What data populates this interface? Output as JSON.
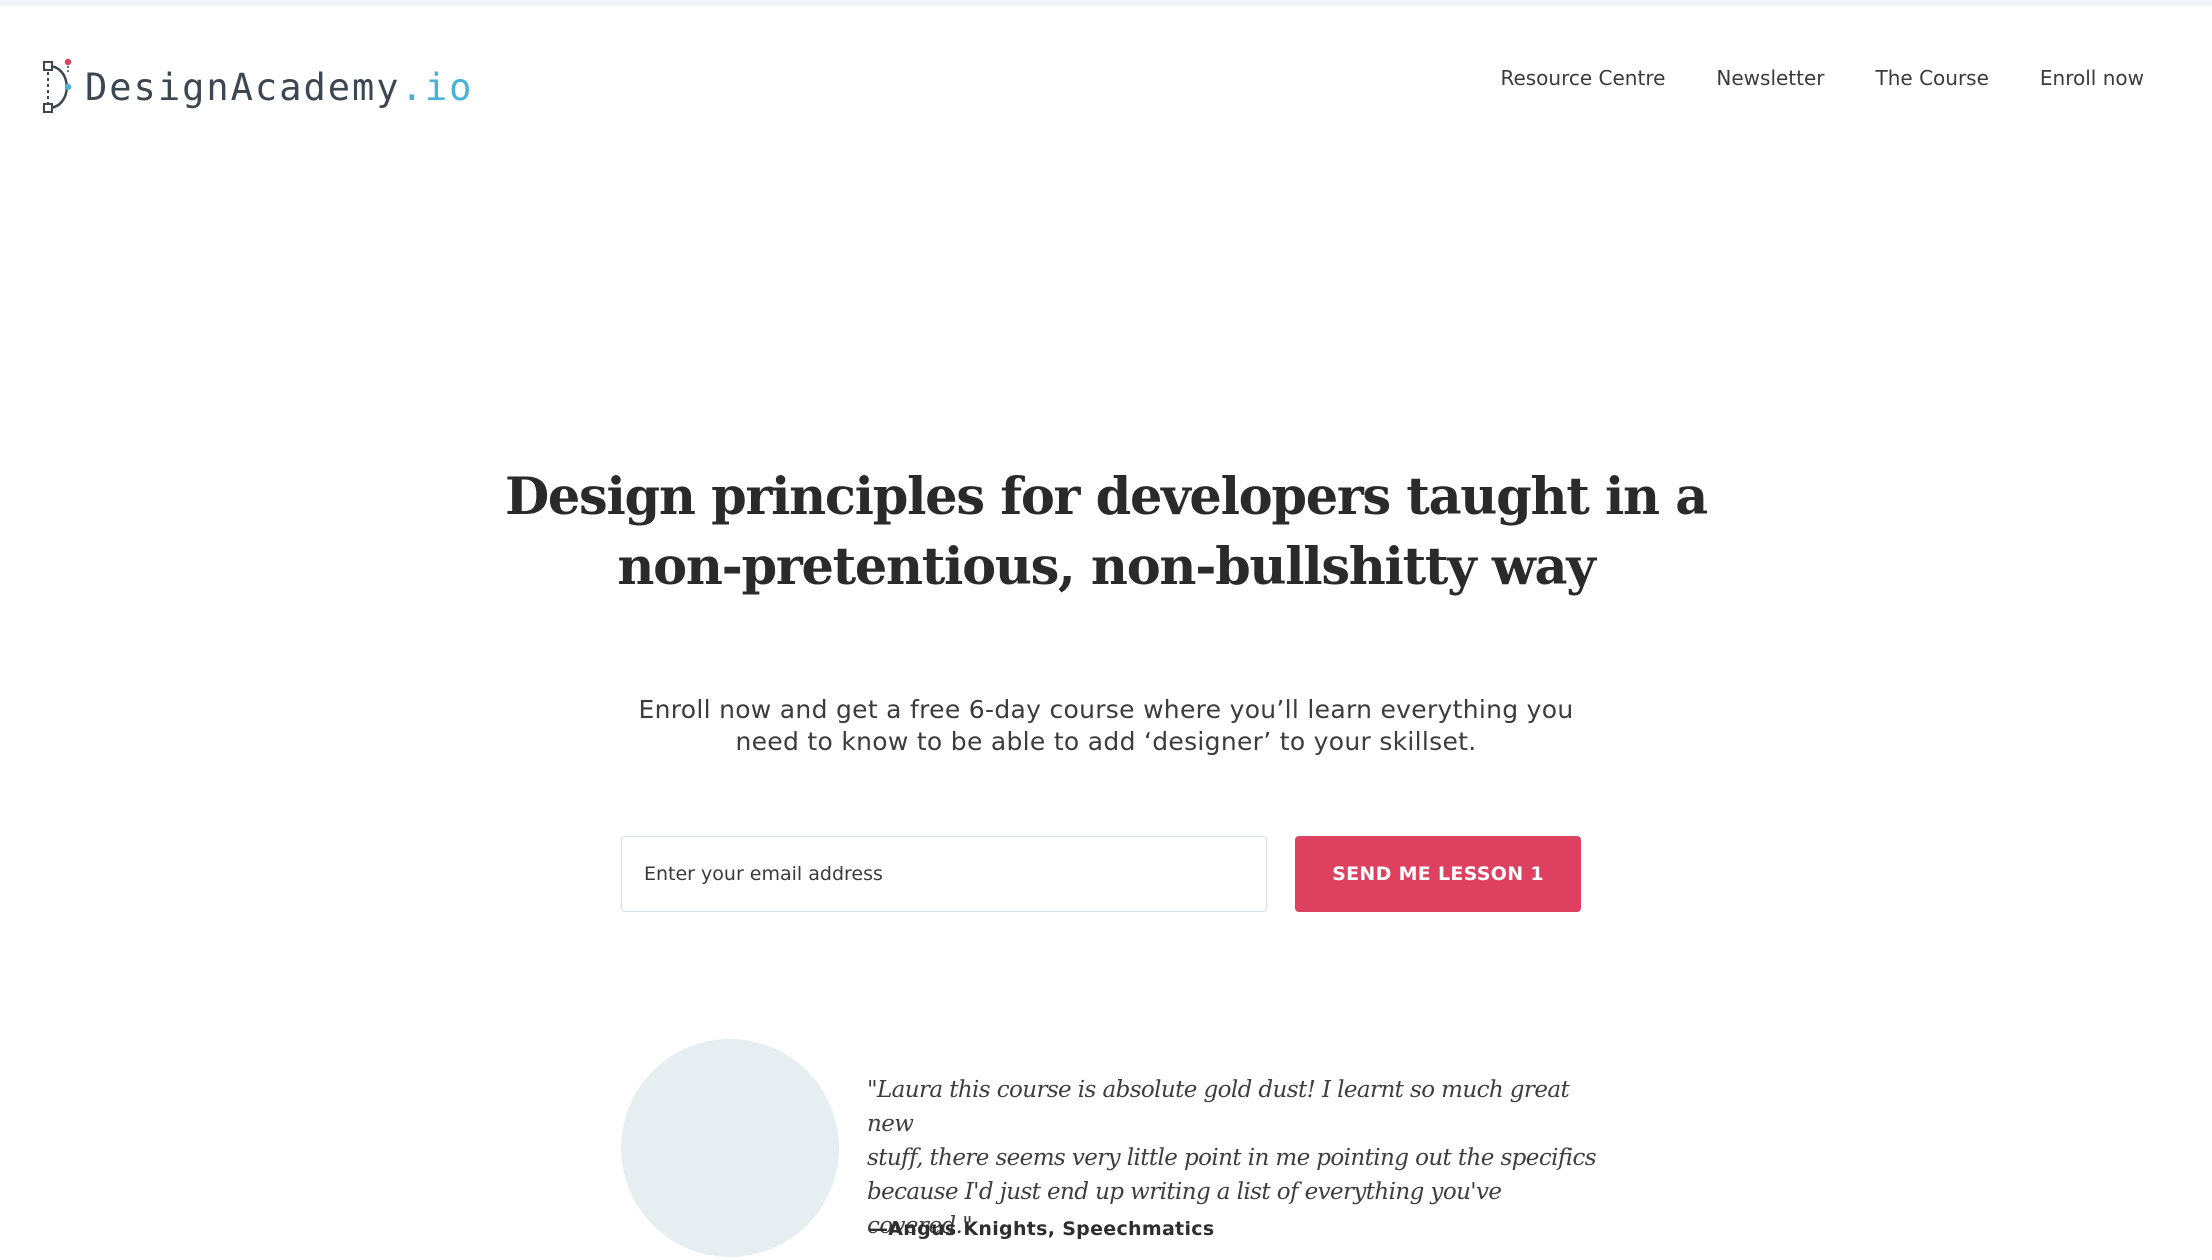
{
  "header": {
    "logo": {
      "name": "DesignAcademy",
      "tld": ".io",
      "icon": "design-academy-logo-icon"
    },
    "nav": [
      {
        "label": "Resource Centre"
      },
      {
        "label": "Newsletter"
      },
      {
        "label": "The Course"
      },
      {
        "label": "Enroll now"
      }
    ]
  },
  "hero": {
    "title_line1": "Design principles for developers taught in a",
    "title_line2": "non-pretentious, non-bullshitty way",
    "subtitle_line1": "Enroll now and get a free 6-day course where you’ll learn everything you",
    "subtitle_line2": "need to know to be able to add ‘designer’ to your skillset."
  },
  "signup": {
    "email_placeholder": "Enter your email address",
    "button_label": "SEND ME LESSON 1"
  },
  "testimonial": {
    "quote_line1": "\"Laura this course is absolute gold dust! I learnt so much great new",
    "quote_line2": "stuff, there seems very little point in me pointing out the specifics",
    "quote_line3": "because I'd just end up writing a list of everything you've covered.\"",
    "author": "—Angus Knights, Speechmatics"
  },
  "colors": {
    "accent": "#de4060",
    "logo_tld": "#47b3d7",
    "avatar_placeholder": "#e7eef2",
    "top_strip": "#f1f5f7"
  }
}
